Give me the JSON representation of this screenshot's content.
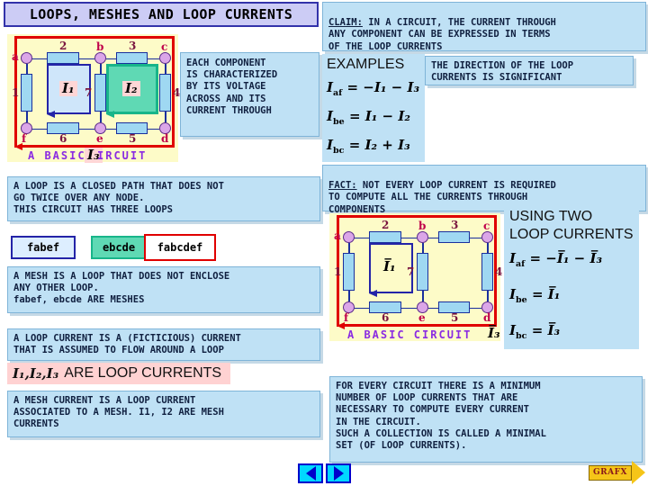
{
  "title": "LOOPS, MESHES AND LOOP CURRENTS",
  "panels": {
    "component": "EACH COMPONENT\nIS CHARACTERIZED\nBY ITS VOLTAGE\nACROSS AND ITS\nCURRENT THROUGH",
    "claim_label": "CLAIM:",
    "claim_text": " IN A CIRCUIT, THE CURRENT THROUGH\nANY COMPONENT CAN BE EXPRESSED IN TERMS\nOF THE LOOP CURRENTS",
    "direction": "THE DIRECTION OF THE LOOP\nCURRENTS IS SIGNIFICANT",
    "fact_label": "FACT:",
    "fact_text": " NOT EVERY LOOP CURRENT IS REQUIRED\nTO COMPUTE ALL THE CURRENTS THROUGH\nCOMPONENTS",
    "loop_def": "A LOOP IS A CLOSED PATH THAT DOES NOT\nGO TWICE OVER ANY NODE.\nTHIS CIRCUIT HAS THREE LOOPS",
    "mesh_def": "A MESH IS A LOOP THAT DOES NOT ENCLOSE\nANY OTHER LOOP.\nfabef, ebcde ARE MESHES",
    "loop_current_def": "A LOOP CURRENT IS A (FICTICIOUS) CURRENT\nTHAT IS ASSUMED TO FLOW AROUND A LOOP",
    "mesh_current_def": "A MESH CURRENT IS A LOOP CURRENT\nASSOCIATED TO A MESH. I1, I2 ARE MESH\nCURRENTS",
    "minimal_set": "FOR EVERY CIRCUIT THERE IS A MINIMUM\nNUMBER OF LOOP CURRENTS THAT ARE\nNECESSARY TO COMPUTE EVERY CURRENT\nIN THE CIRCUIT.\nSUCH A COLLECTION IS CALLED A MINIMAL\nSET (OF LOOP CURRENTS)."
  },
  "loop_chips": [
    {
      "id": "fabef",
      "label": "fabef"
    },
    {
      "id": "ebcde",
      "label": "ebcde"
    },
    {
      "id": "fabcdef",
      "label": "fabcdef"
    }
  ],
  "loop_currents_line": {
    "math": "I₁,I₂,I₃",
    "text": "ARE  LOOP CURRENTS"
  },
  "examples": {
    "heading": "EXAMPLES",
    "equations": [
      {
        "lhs": "I",
        "lhs_sub": "af",
        "rhs": "= −I₁ − I₃"
      },
      {
        "lhs": "I",
        "lhs_sub": "be",
        "rhs": "= I₁ − I₂"
      },
      {
        "lhs": "I",
        "lhs_sub": "bc",
        "rhs": "= I₂ + I₃"
      }
    ]
  },
  "using_two": {
    "heading": "USING TWO\nLOOP CURRENTS",
    "equations": [
      {
        "lhs": "I",
        "lhs_sub": "af",
        "rhs": "= −I̅₁ − I̅₃"
      },
      {
        "lhs": "I",
        "lhs_sub": "be",
        "rhs": "= I̅₁"
      },
      {
        "lhs": "I",
        "lhs_sub": "bc",
        "rhs": "= I̅₃"
      }
    ]
  },
  "circuit1": {
    "caption_left": "A BASIC",
    "caption_right": "IRCUIT",
    "node_labels": [
      "a",
      "b",
      "c",
      "d",
      "e",
      "f"
    ],
    "component_labels": [
      "1",
      "2",
      "3",
      "4",
      "5",
      "6",
      "7"
    ],
    "loop_currents": [
      "I₁",
      "I₂",
      "I₃"
    ]
  },
  "circuit2": {
    "caption": "A BASIC CIRCUIT",
    "node_labels": [
      "a",
      "b",
      "c",
      "d",
      "e",
      "f"
    ],
    "component_labels": [
      "1",
      "2",
      "3",
      "4",
      "5",
      "6",
      "7"
    ],
    "loop_currents": [
      "I̅₁",
      "I̅₃"
    ]
  },
  "nav": {
    "prev": "previous-slide",
    "next": "next-slide",
    "logo": "GRAFX"
  },
  "colors": {
    "title_bg": "#ccccf5",
    "title_border": "#3333aa",
    "panel_bg": "#bfe1f5",
    "panel_border": "#7fb4d8",
    "circuit_bg": "#fdfbc8",
    "circuit_border": "#e00000",
    "resistor": "#9fd8f2",
    "resistor_border": "#1a2f9e",
    "node": "#dba6e8",
    "loop1": "#2424a8",
    "loop2": "#18b58a",
    "loop3": "#e00000",
    "highlight_pink": "#ffd2d2"
  }
}
